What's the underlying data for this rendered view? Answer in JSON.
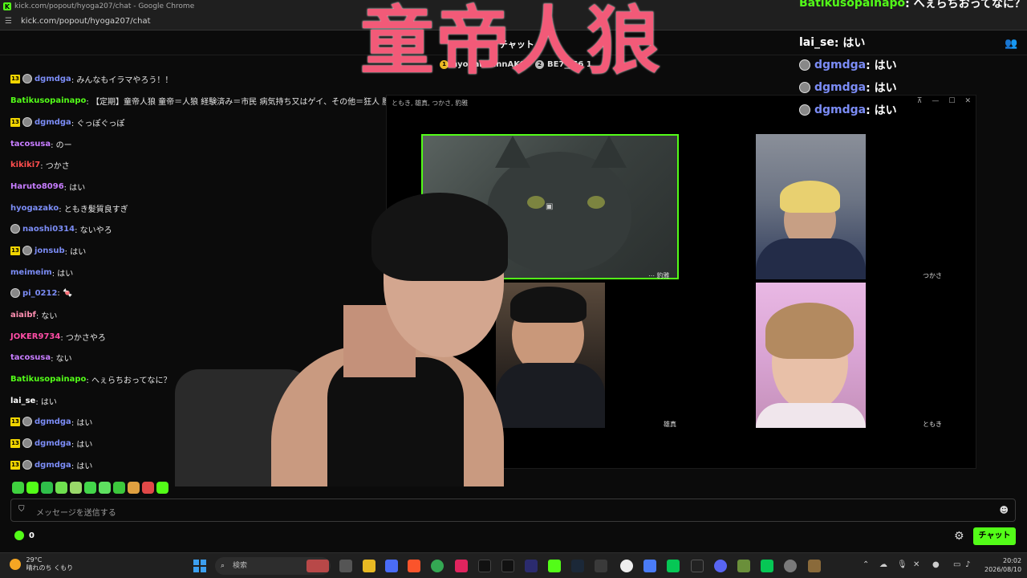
{
  "browser": {
    "title": "kick.com/popout/hyoga207/chat - Google Chrome",
    "url": "kick.com/popout/hyoga207/chat"
  },
  "chat_header": {
    "title": "チャット"
  },
  "pinned": [
    {
      "rank": "1",
      "name": "hyogakunnnAKO"
    },
    {
      "rank": "2",
      "name": "BE7__56 1"
    }
  ],
  "messages": [
    {
      "user": "dgmdga",
      "text": ": みんなもイラマやろう！！",
      "color": "#7b8cf5",
      "sub": "13",
      "avatar": true
    },
    {
      "user": "Batikusopainapo",
      "text": ": 【定期】童帝人狼 童帝＝人狼 経験済み＝市民 病気持ち又はゲイ、その他＝狂人 腰の動き・",
      "color": "#53fc18",
      "sub": "",
      "avatar": false
    },
    {
      "user": "dgmdga",
      "text": ": ぐっぽぐっぽ",
      "color": "#7b8cf5",
      "sub": "13",
      "avatar": true
    },
    {
      "user": "tacosusa",
      "text": ": のー",
      "color": "#c77dff",
      "sub": "",
      "avatar": false
    },
    {
      "user": "kikiki7",
      "text": ": つかさ",
      "color": "#ff4d4d",
      "sub": "",
      "avatar": false
    },
    {
      "user": "Haruto8096",
      "text": ": はい",
      "color": "#c77dff",
      "sub": "",
      "avatar": false
    },
    {
      "user": "hyogazako",
      "text": ": ともき髪質良すぎ",
      "color": "#7b8cf5",
      "sub": "",
      "avatar": false
    },
    {
      "user": "naoshi0314",
      "text": ": ないやろ",
      "color": "#7b8cf5",
      "sub": "",
      "avatar": true
    },
    {
      "user": "jonsub",
      "text": ": はい",
      "color": "#7b8cf5",
      "sub": "13",
      "avatar": true
    },
    {
      "user": "meimeim",
      "text": ": はい",
      "color": "#7b8cf5",
      "sub": "",
      "avatar": false
    },
    {
      "user": "pi_0212",
      "text": ": 🍬",
      "color": "#7b8cf5",
      "sub": "",
      "avatar": true
    },
    {
      "user": "aiaibf",
      "text": ": ない",
      "color": "#ff8fb1",
      "sub": "",
      "avatar": false
    },
    {
      "user": "JOKER9734",
      "text": ": つかさやろ",
      "color": "#ff4da6",
      "sub": "",
      "avatar": false
    },
    {
      "user": "tacosusa",
      "text": ": ない",
      "color": "#c77dff",
      "sub": "",
      "avatar": false
    },
    {
      "user": "Batikusopainapo",
      "text": ": へぇらちおってなに？",
      "color": "#53fc18",
      "sub": "",
      "avatar": false
    },
    {
      "user": "lai_se",
      "text": ": はい",
      "color": "#ffffff",
      "sub": "",
      "avatar": false
    },
    {
      "user": "dgmdga",
      "text": ": はい",
      "color": "#7b8cf5",
      "sub": "13",
      "avatar": true
    },
    {
      "user": "dgmdga",
      "text": ": はい",
      "color": "#7b8cf5",
      "sub": "13",
      "avatar": true
    },
    {
      "user": "dgmdga",
      "text": ": はい",
      "color": "#7b8cf5",
      "sub": "13",
      "avatar": true
    }
  ],
  "overlay": {
    "big_title": "童帝人狼",
    "chat": [
      {
        "user": "Batikusopainapo",
        "text": " : へぇらちおってなに？",
        "color": "#53fc18",
        "avatar": false
      },
      {
        "user": "lai_se",
        "text": " : はい",
        "color": "#ffffff",
        "avatar": false
      },
      {
        "user": "dgmdga",
        "text": " : はい",
        "color": "#7b8cf5",
        "avatar": true
      },
      {
        "user": "dgmdga",
        "text": " : はい",
        "color": "#7b8cf5",
        "avatar": true
      },
      {
        "user": "dgmdga",
        "text": " : はい",
        "color": "#7b8cf5",
        "avatar": true
      }
    ]
  },
  "call": {
    "title": "ともき, 雄真, つかさ, 豹雅",
    "tiles": [
      {
        "label": "豹雅"
      },
      {
        "label": "雄真"
      },
      {
        "label": "つかさ"
      },
      {
        "label": "ともき"
      }
    ]
  },
  "input": {
    "placeholder": "メッセージを送信する"
  },
  "points": {
    "value": "0"
  },
  "send_button": "チャット",
  "taskbar": {
    "temp": "29°C",
    "weather": "晴れのち くもり",
    "search": "検索",
    "time": "20:02",
    "date": "2026/08/10"
  },
  "colors": {
    "accent": "#53fc18",
    "title_pink": "#f25a78"
  }
}
